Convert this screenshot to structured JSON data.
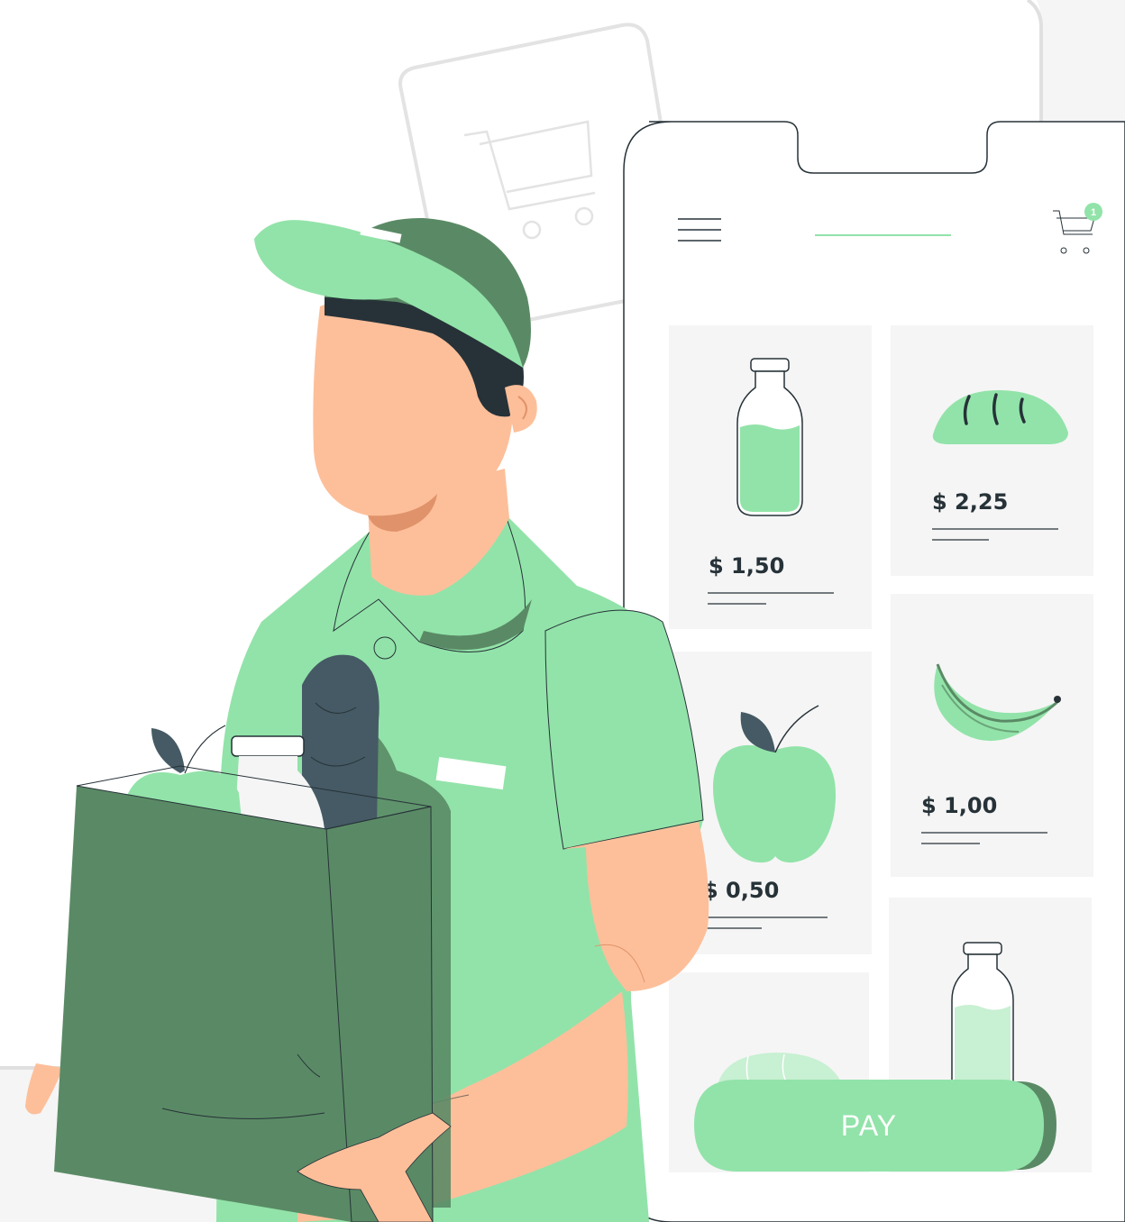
{
  "colors": {
    "accent": "#92E3A9",
    "accent_dark": "#5A8A65",
    "skin": "#FDBF9A",
    "dark": "#263238",
    "card_bg": "#F5F5F5",
    "outline": "#263238"
  },
  "header": {
    "menu_icon": "hamburger-menu-icon",
    "cart_icon": "shopping-cart-icon",
    "cart_badge": "1"
  },
  "products": [
    {
      "icon": "milk-bottle-icon",
      "price": "$ 1,50"
    },
    {
      "icon": "bread-icon",
      "price": "$ 2,25"
    },
    {
      "icon": "apple-icon",
      "price": "$ 0,50"
    },
    {
      "icon": "banana-icon",
      "price": "$ 1,00"
    },
    {
      "icon": "cabbage-icon",
      "price": ""
    },
    {
      "icon": "milk-bottle-icon",
      "price": ""
    }
  ],
  "pay_button": {
    "label": "PAY"
  }
}
